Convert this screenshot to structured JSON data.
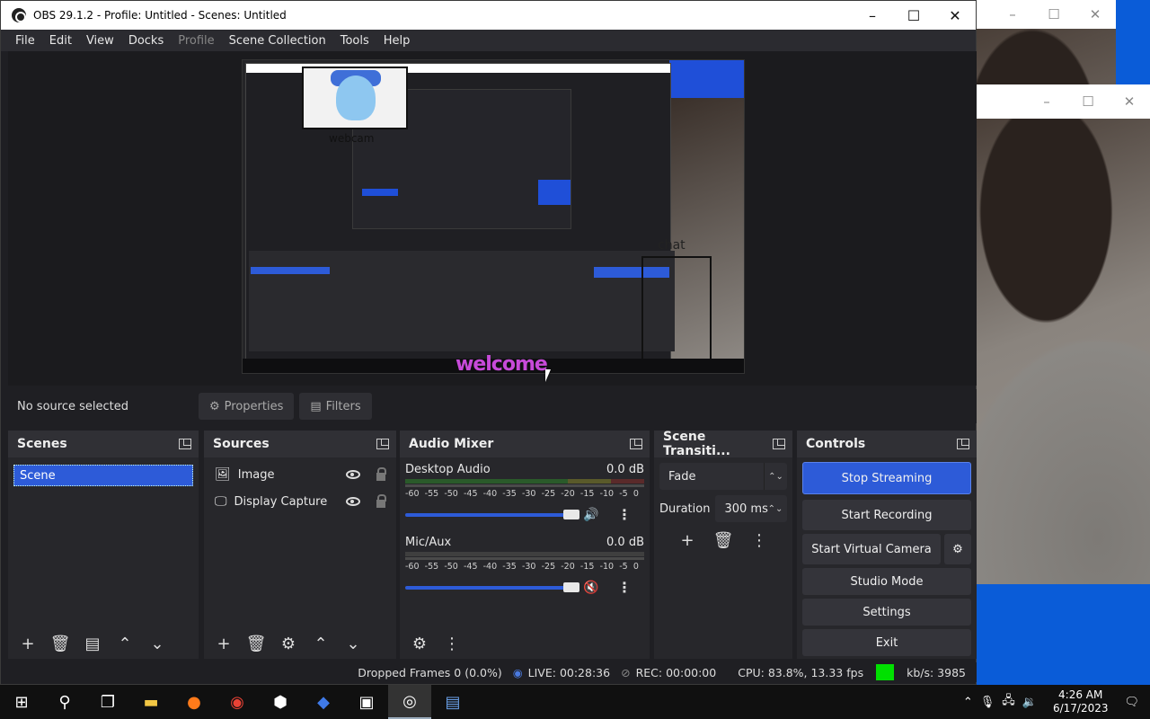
{
  "window": {
    "title": "OBS 29.1.2 - Profile: Untitled - Scenes: Untitled",
    "minimize": "–",
    "maximize": "☐",
    "close": "✕"
  },
  "menu": [
    {
      "label": "File",
      "enabled": true
    },
    {
      "label": "Edit",
      "enabled": true
    },
    {
      "label": "View",
      "enabled": true
    },
    {
      "label": "Docks",
      "enabled": true
    },
    {
      "label": "Profile",
      "enabled": false
    },
    {
      "label": "Scene Collection",
      "enabled": true
    },
    {
      "label": "Tools",
      "enabled": true
    },
    {
      "label": "Help",
      "enabled": true
    }
  ],
  "preview": {
    "welcome_text": "welcome",
    "webcam_text": "webcam",
    "chat_text": "chat"
  },
  "source_toolbar": {
    "status": "No source selected",
    "properties": "Properties",
    "filters": "Filters"
  },
  "scenes": {
    "title": "Scenes",
    "items": [
      "Scene"
    ]
  },
  "sources": {
    "title": "Sources",
    "items": [
      {
        "name": "Image",
        "icon": "image-icon"
      },
      {
        "name": "Display Capture",
        "icon": "monitor-icon"
      }
    ]
  },
  "mixer": {
    "title": "Audio Mixer",
    "scale": [
      "-60",
      "-55",
      "-50",
      "-45",
      "-40",
      "-35",
      "-30",
      "-25",
      "-20",
      "-15",
      "-10",
      "-5",
      "0"
    ],
    "channels": [
      {
        "name": "Desktop Audio",
        "db": "0.0 dB",
        "muted": false
      },
      {
        "name": "Mic/Aux",
        "db": "0.0 dB",
        "muted": true
      }
    ]
  },
  "transitions": {
    "title": "Scene Transiti...",
    "selected": "Fade",
    "duration_label": "Duration",
    "duration_value": "300 ms"
  },
  "controls": {
    "title": "Controls",
    "stop_streaming": "Stop Streaming",
    "start_recording": "Start Recording",
    "start_virtual_camera": "Start Virtual Camera",
    "studio_mode": "Studio Mode",
    "settings": "Settings",
    "exit": "Exit"
  },
  "status": {
    "dropped": "Dropped Frames 0 (0.0%)",
    "live": "LIVE: 00:28:36",
    "rec": "REC: 00:00:00",
    "cpu": "CPU: 83.8%, 13.33 fps",
    "kbps": "kb/s: 3985"
  },
  "clock": {
    "time": "4:26 AM",
    "date": "6/17/2023"
  },
  "colors": {
    "accent": "#2d5bd8",
    "live_indicator": "#00e000",
    "desktop_bg": "#0a5cd8"
  }
}
